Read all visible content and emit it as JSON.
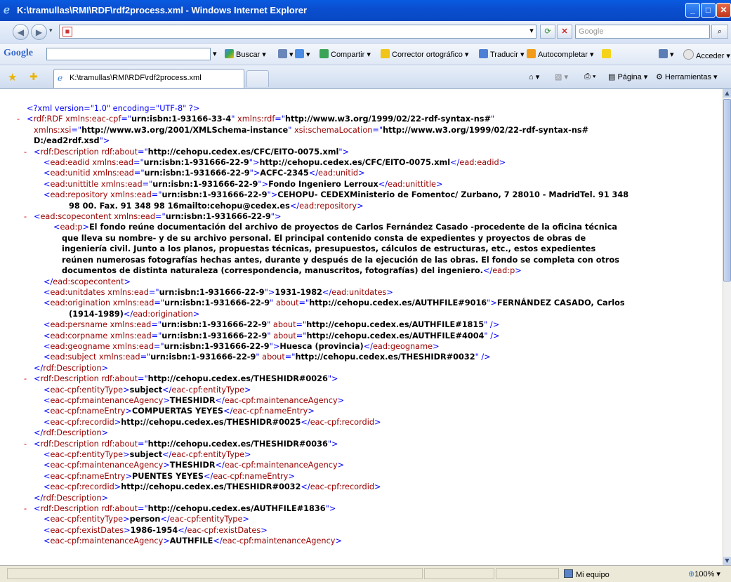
{
  "window": {
    "title": "K:\\tramullas\\RMI\\RDF\\rdf2process.xml - Windows Internet Explorer"
  },
  "navbar": {
    "search_placeholder": "Google"
  },
  "google_bar": {
    "logo": "Google",
    "buscar": "Buscar",
    "compartir": "Compartir",
    "corrector": "Corrector ortográfico",
    "traducir": "Traducir",
    "autocompletar": "Autocompletar",
    "acceder": "Acceder"
  },
  "tabs": {
    "active_tab": "K:\\tramullas\\RMI\\RDF\\rdf2process.xml",
    "pagina": "Página",
    "herramientas": "Herramientas"
  },
  "xml_lines": [
    {
      "i": 0,
      "m": "",
      "h": "<span class=\"p\">&lt;?xml version=\"1.0\" encoding=\"UTF-8\" ?&gt;</span>"
    },
    {
      "i": 0,
      "m": "-",
      "h": "<span class=\"p\">&lt;</span><span class=\"t\">rdf:RDF</span> <span class=\"a\">xmlns:eac-cpf</span><span class=\"p\">=\"</span><span class=\"v\">urn:isbn:1-93166-33-4</span><span class=\"p\">\"</span> <span class=\"a\">xmlns:rdf</span><span class=\"p\">=\"</span><span class=\"v\">http://www.w3.org/1999/02/22-rdf-syntax-ns#</span><span class=\"p\">\"</span>"
    },
    {
      "i": 1,
      "m": "",
      "h": "<span class=\"a\">xmlns:xsi</span><span class=\"p\">=\"</span><span class=\"v\">http://www.w3.org/2001/XMLSchema-instance</span><span class=\"p\">\"</span> <span class=\"a\">xsi:schemaLocation</span><span class=\"p\">=\"</span><span class=\"v\">http://www.w3.org/1999/02/22-rdf-syntax-ns#</span>"
    },
    {
      "i": 1,
      "m": "",
      "h": "<span class=\"v\">D:/ead2rdf.xsd</span><span class=\"p\">\"&gt;</span>"
    },
    {
      "i": 1,
      "m": "-",
      "h": "<span class=\"p\">&lt;</span><span class=\"t\">rdf:Description</span> <span class=\"a\">rdf:about</span><span class=\"p\">=\"</span><span class=\"v\">http://cehopu.cedex.es/CFC/EITO-0075.xml</span><span class=\"p\">\"&gt;</span>"
    },
    {
      "i": 2,
      "m": "",
      "h": "<span class=\"p\">&lt;</span><span class=\"t\">ead:eadid</span> <span class=\"a\">xmlns:ead</span><span class=\"p\">=\"</span><span class=\"v\">urn:isbn:1-931666-22-9</span><span class=\"p\">\"&gt;</span><span class=\"txt\">http://cehopu.cedex.es/CFC/EITO-0075.xml</span><span class=\"p\">&lt;/</span><span class=\"t\">ead:eadid</span><span class=\"p\">&gt;</span>"
    },
    {
      "i": 2,
      "m": "",
      "h": "<span class=\"p\">&lt;</span><span class=\"t\">ead:unitid</span> <span class=\"a\">xmlns:ead</span><span class=\"p\">=\"</span><span class=\"v\">urn:isbn:1-931666-22-9</span><span class=\"p\">\"&gt;</span><span class=\"txt\">ACFC-2345</span><span class=\"p\">&lt;/</span><span class=\"t\">ead:unitid</span><span class=\"p\">&gt;</span>"
    },
    {
      "i": 2,
      "m": "",
      "h": "<span class=\"p\">&lt;</span><span class=\"t\">ead:unittitle</span> <span class=\"a\">xmlns:ead</span><span class=\"p\">=\"</span><span class=\"v\">urn:isbn:1-931666-22-9</span><span class=\"p\">\"&gt;</span><span class=\"txt\">Fondo Ingeniero Lerroux</span><span class=\"p\">&lt;/</span><span class=\"t\">ead:unittitle</span><span class=\"p\">&gt;</span>"
    },
    {
      "i": 2,
      "m": "",
      "h": "<span class=\"p\">&lt;</span><span class=\"t\">ead:repository</span> <span class=\"a\">xmlns:ead</span><span class=\"p\">=\"</span><span class=\"v\">urn:isbn:1-931666-22-9</span><span class=\"p\">\"&gt;</span><span class=\"txt\">CEHOPU- CEDEXMinisterio de Fomentoc/ Zurbano, 7 28010 - MadridTel. 91 348</span>"
    },
    {
      "i": 3,
      "m": "",
      "h": "<span class=\"txt\">98 00. Fax. 91 348 98 16mailto:cehopu@cedex.es</span><span class=\"p\">&lt;/</span><span class=\"t\">ead:repository</span><span class=\"p\">&gt;</span>"
    },
    {
      "i": 1,
      "m": "-",
      "h": "<span class=\"p\">&lt;</span><span class=\"t\">ead:scopecontent</span> <span class=\"a\">xmlns:ead</span><span class=\"p\">=\"</span><span class=\"v\">urn:isbn:1-931666-22-9</span><span class=\"p\">\"&gt;</span>",
      "ind": 2
    },
    {
      "i": 3,
      "m": "",
      "h": "<span class=\"p\">&lt;</span><span class=\"t\">ead:p</span><span class=\"p\">&gt;</span><span class=\"txt\">El fondo reúne documentación del archivo de proyectos de Carlos Fernández Casado -procedente de la oficina técnica</span>"
    },
    {
      "i": 4,
      "m": "",
      "h": "<span class=\"txt\">que lleva su nombre- y de su archivo personal. El principal contenido consta de expedientes y proyectos de obras de</span>"
    },
    {
      "i": 4,
      "m": "",
      "h": "<span class=\"txt\">ingeniería civil. Junto a los planos, propuestas técnicas, presupuestos, cálculos de estructuras, etc., estos expedientes</span>"
    },
    {
      "i": 4,
      "m": "",
      "h": "<span class=\"txt\">reúnen numerosas fotografías hechas antes, durante y después de la ejecución de las obras. El fondo se completa con otros</span>"
    },
    {
      "i": 4,
      "m": "",
      "h": "<span class=\"txt\">documentos de distinta naturaleza (correspondencia, manuscritos, fotografías) del ingeniero.</span><span class=\"p\">&lt;/</span><span class=\"t\">ead:p</span><span class=\"p\">&gt;</span>"
    },
    {
      "i": 2,
      "m": "",
      "h": "<span class=\"p\">&lt;/</span><span class=\"t\">ead:scopecontent</span><span class=\"p\">&gt;</span>"
    },
    {
      "i": 2,
      "m": "",
      "h": "<span class=\"p\">&lt;</span><span class=\"t\">ead:unitdates</span> <span class=\"a\">xmlns:ead</span><span class=\"p\">=\"</span><span class=\"v\">urn:isbn:1-931666-22-9</span><span class=\"p\">\"&gt;</span><span class=\"txt\">1931-1982</span><span class=\"p\">&lt;/</span><span class=\"t\">ead:unitdates</span><span class=\"p\">&gt;</span>"
    },
    {
      "i": 2,
      "m": "",
      "h": "<span class=\"p\">&lt;</span><span class=\"t\">ead:origination</span> <span class=\"a\">xmlns:ead</span><span class=\"p\">=\"</span><span class=\"v\">urn:isbn:1-931666-22-9</span><span class=\"p\">\"</span> <span class=\"a\">about</span><span class=\"p\">=\"</span><span class=\"v\">http://cehopu.cedex.es/AUTHFILE#9016</span><span class=\"p\">\"&gt;</span><span class=\"txt\">FERNÁNDEZ CASADO, Carlos</span>"
    },
    {
      "i": 3,
      "m": "",
      "h": "<span class=\"txt\">(1914-1989)</span><span class=\"p\">&lt;/</span><span class=\"t\">ead:origination</span><span class=\"p\">&gt;</span>"
    },
    {
      "i": 2,
      "m": "",
      "h": "<span class=\"p\">&lt;</span><span class=\"t\">ead:persname</span> <span class=\"a\">xmlns:ead</span><span class=\"p\">=\"</span><span class=\"v\">urn:isbn:1-931666-22-9</span><span class=\"p\">\"</span> <span class=\"a\">about</span><span class=\"p\">=\"</span><span class=\"v\">http://cehopu.cedex.es/AUTHFILE#1815</span><span class=\"p\">\" /&gt;</span>"
    },
    {
      "i": 2,
      "m": "",
      "h": "<span class=\"p\">&lt;</span><span class=\"t\">ead:corpname</span> <span class=\"a\">xmlns:ead</span><span class=\"p\">=\"</span><span class=\"v\">urn:isbn:1-931666-22-9</span><span class=\"p\">\"</span> <span class=\"a\">about</span><span class=\"p\">=\"</span><span class=\"v\">http://cehopu.cedex.es/AUTHFILE#4004</span><span class=\"p\">\" /&gt;</span>"
    },
    {
      "i": 2,
      "m": "",
      "h": "<span class=\"p\">&lt;</span><span class=\"t\">ead:geogname</span> <span class=\"a\">xmlns:ead</span><span class=\"p\">=\"</span><span class=\"v\">urn:isbn:1-931666-22-9</span><span class=\"p\">\"&gt;</span><span class=\"txt\">Huesca (provincia)</span><span class=\"p\">&lt;/</span><span class=\"t\">ead:geogname</span><span class=\"p\">&gt;</span>"
    },
    {
      "i": 2,
      "m": "",
      "h": "<span class=\"p\">&lt;</span><span class=\"t\">ead:subject</span> <span class=\"a\">xmlns:ead</span><span class=\"p\">=\"</span><span class=\"v\">urn:isbn:1-931666-22-9</span><span class=\"p\">\"</span> <span class=\"a\">about</span><span class=\"p\">=\"</span><span class=\"v\">http://cehopu.cedex.es/THESHIDR#0032</span><span class=\"p\">\" /&gt;</span>"
    },
    {
      "i": 1,
      "m": "",
      "h": "<span class=\"p\">&lt;/</span><span class=\"t\">rdf:Description</span><span class=\"p\">&gt;</span>",
      "ind": 2
    },
    {
      "i": 1,
      "m": "-",
      "h": "<span class=\"p\">&lt;</span><span class=\"t\">rdf:Description</span> <span class=\"a\">rdf:about</span><span class=\"p\">=\"</span><span class=\"v\">http://cehopu.cedex.es/THESHIDR#0026</span><span class=\"p\">\"&gt;</span>"
    },
    {
      "i": 2,
      "m": "",
      "h": "<span class=\"p\">&lt;</span><span class=\"t\">eac-cpf:entityType</span><span class=\"p\">&gt;</span><span class=\"txt\">subject</span><span class=\"p\">&lt;/</span><span class=\"t\">eac-cpf:entityType</span><span class=\"p\">&gt;</span>"
    },
    {
      "i": 2,
      "m": "",
      "h": "<span class=\"p\">&lt;</span><span class=\"t\">eac-cpf:maintenanceAgency</span><span class=\"p\">&gt;</span><span class=\"txt\">THESHIDR</span><span class=\"p\">&lt;/</span><span class=\"t\">eac-cpf:maintenanceAgency</span><span class=\"p\">&gt;</span>"
    },
    {
      "i": 2,
      "m": "",
      "h": "<span class=\"p\">&lt;</span><span class=\"t\">eac-cpf:nameEntry</span><span class=\"p\">&gt;</span><span class=\"txt\">COMPUERTAS YEYES</span><span class=\"p\">&lt;/</span><span class=\"t\">eac-cpf:nameEntry</span><span class=\"p\">&gt;</span>"
    },
    {
      "i": 2,
      "m": "",
      "h": "<span class=\"p\">&lt;</span><span class=\"t\">eac-cpf:recordid</span><span class=\"p\">&gt;</span><span class=\"txt\">http://cehopu.cedex.es/THESHIDR#0025</span><span class=\"p\">&lt;/</span><span class=\"t\">eac-cpf:recordid</span><span class=\"p\">&gt;</span>"
    },
    {
      "i": 1,
      "m": "",
      "h": "<span class=\"p\">&lt;/</span><span class=\"t\">rdf:Description</span><span class=\"p\">&gt;</span>",
      "ind": 2
    },
    {
      "i": 1,
      "m": "-",
      "h": "<span class=\"p\">&lt;</span><span class=\"t\">rdf:Description</span> <span class=\"a\">rdf:about</span><span class=\"p\">=\"</span><span class=\"v\">http://cehopu.cedex.es/THESHIDR#0036</span><span class=\"p\">\"&gt;</span>"
    },
    {
      "i": 2,
      "m": "",
      "h": "<span class=\"p\">&lt;</span><span class=\"t\">eac-cpf:entityType</span><span class=\"p\">&gt;</span><span class=\"txt\">subject</span><span class=\"p\">&lt;/</span><span class=\"t\">eac-cpf:entityType</span><span class=\"p\">&gt;</span>"
    },
    {
      "i": 2,
      "m": "",
      "h": "<span class=\"p\">&lt;</span><span class=\"t\">eac-cpf:maintenanceAgency</span><span class=\"p\">&gt;</span><span class=\"txt\">THESHIDR</span><span class=\"p\">&lt;/</span><span class=\"t\">eac-cpf:maintenanceAgency</span><span class=\"p\">&gt;</span>"
    },
    {
      "i": 2,
      "m": "",
      "h": "<span class=\"p\">&lt;</span><span class=\"t\">eac-cpf:nameEntry</span><span class=\"p\">&gt;</span><span class=\"txt\">PUENTES YEYES</span><span class=\"p\">&lt;/</span><span class=\"t\">eac-cpf:nameEntry</span><span class=\"p\">&gt;</span>"
    },
    {
      "i": 2,
      "m": "",
      "h": "<span class=\"p\">&lt;</span><span class=\"t\">eac-cpf:recordid</span><span class=\"p\">&gt;</span><span class=\"txt\">http://cehopu.cedex.es/THESHIDR#0032</span><span class=\"p\">&lt;/</span><span class=\"t\">eac-cpf:recordid</span><span class=\"p\">&gt;</span>"
    },
    {
      "i": 1,
      "m": "",
      "h": "<span class=\"p\">&lt;/</span><span class=\"t\">rdf:Description</span><span class=\"p\">&gt;</span>",
      "ind": 2
    },
    {
      "i": 1,
      "m": "-",
      "h": "<span class=\"p\">&lt;</span><span class=\"t\">rdf:Description</span> <span class=\"a\">rdf:about</span><span class=\"p\">=\"</span><span class=\"v\">http://cehopu.cedex.es/AUTHFILE#1836</span><span class=\"p\">\"&gt;</span>"
    },
    {
      "i": 2,
      "m": "",
      "h": "<span class=\"p\">&lt;</span><span class=\"t\">eac-cpf:entityType</span><span class=\"p\">&gt;</span><span class=\"txt\">person</span><span class=\"p\">&lt;/</span><span class=\"t\">eac-cpf:entityType</span><span class=\"p\">&gt;</span>"
    },
    {
      "i": 2,
      "m": "",
      "h": "<span class=\"p\">&lt;</span><span class=\"t\">eac-cpf:existDates</span><span class=\"p\">&gt;</span><span class=\"txt\">1986-1954</span><span class=\"p\">&lt;/</span><span class=\"t\">eac-cpf:existDates</span><span class=\"p\">&gt;</span>"
    },
    {
      "i": 2,
      "m": "",
      "h": "<span class=\"p\">&lt;</span><span class=\"t\">eac-cpf:maintenanceAgency</span><span class=\"p\">&gt;</span><span class=\"txt\">AUTHFILE</span><span class=\"p\">&lt;/</span><span class=\"t\">eac-cpf:maintenanceAgency</span><span class=\"p\">&gt;</span>"
    }
  ],
  "status": {
    "zone": "Mi equipo",
    "zoom": "100%"
  }
}
